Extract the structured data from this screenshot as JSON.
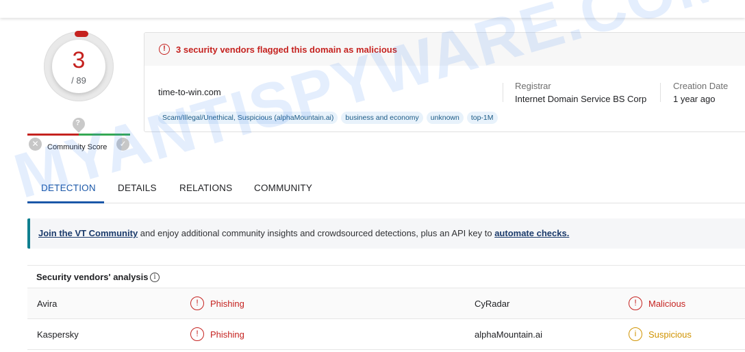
{
  "score": {
    "detections": "3",
    "total": "/ 89"
  },
  "community": {
    "label": "Community Score",
    "pin_glyph": "?"
  },
  "alert": {
    "text": "3 security vendors flagged this domain as malicious"
  },
  "domain": "time-to-win.com",
  "tags": [
    "Scam/Illegal/Unethical, Suspicious (alphaMountain.ai)",
    "business and economy",
    "unknown",
    "top-1M"
  ],
  "registrar": {
    "label": "Registrar",
    "value": "Internet Domain Service BS Corp"
  },
  "creation": {
    "label": "Creation Date",
    "value": "1 year ago"
  },
  "tabs": [
    "DETECTION",
    "DETAILS",
    "RELATIONS",
    "COMMUNITY"
  ],
  "banner": {
    "link1": "Join the VT Community",
    "middle": " and enjoy additional community insights and crowdsourced detections, plus an API key to ",
    "link2": "automate checks."
  },
  "vendors": {
    "title": "Security vendors' analysis",
    "rows": [
      {
        "left_name": "Avira",
        "left_verdict": "Phishing",
        "right_name": "CyRadar",
        "right_verdict": "Malicious"
      },
      {
        "left_name": "Kaspersky",
        "left_verdict": "Phishing",
        "right_name": "alphaMountain.ai",
        "right_verdict": "Suspicious"
      }
    ]
  },
  "watermark": "MYANTISPYWARE.COM",
  "colors": {
    "malicious": "#c5221f",
    "suspicious": "#d09300",
    "accent": "#1a57a8",
    "banner_border": "#0f7f8f"
  }
}
